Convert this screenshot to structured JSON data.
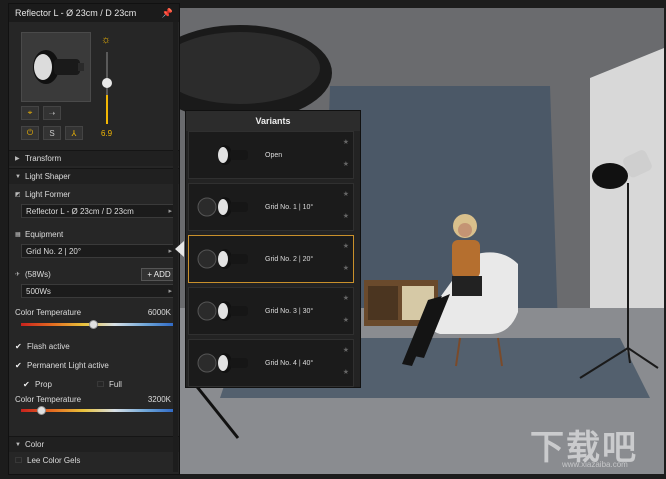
{
  "panel": {
    "title": "Reflector L - Ø 23cm / D 23cm",
    "intensity_value": "6.9",
    "sections": {
      "transform": "Transform",
      "light_shaper": "Light Shaper",
      "light_former": "Light Former",
      "light_former_value": "Reflector L - Ø 23cm / D 23cm",
      "equipment": "Equipment",
      "equipment_value": "Grid No. 2 | 20°",
      "power_label": "(58Ws)",
      "add_label": "+ ADD",
      "power_value": "500Ws",
      "color_temp_label": "Color Temperature",
      "color_temp_value": "6000K",
      "flash_active": "Flash active",
      "permanent_light": "Permanent Light active",
      "prop": "Prop",
      "full": "Full",
      "color_temp_label2": "Color Temperature",
      "color_temp_value2": "3200K",
      "color": "Color",
      "lee_gels": "Lee Color Gels"
    },
    "mode_buttons": [
      "S"
    ]
  },
  "variants": {
    "title": "Variants",
    "items": [
      {
        "label": "Open"
      },
      {
        "label": "Grid No. 1 | 10°"
      },
      {
        "label": "Grid No. 2 | 20°"
      },
      {
        "label": "Grid No. 3 | 30°"
      },
      {
        "label": "Grid No. 4 | 40°"
      }
    ],
    "selected_index": 2
  },
  "colors": {
    "accent": "#f2b705",
    "selected_border": "#c9902b",
    "panel_bg": "#262626"
  },
  "watermark": {
    "text": "下载吧",
    "subtext": "www.xiazaiba.com"
  }
}
